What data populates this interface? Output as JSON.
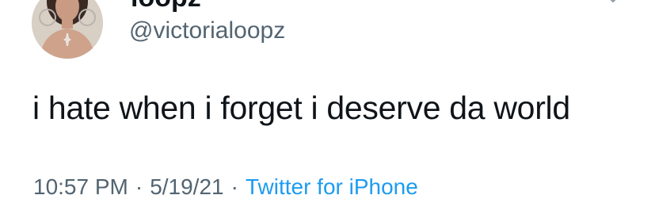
{
  "tweet": {
    "display_name": "loopz",
    "handle": "@victorialoopz",
    "text": "i hate when i forget i deserve da world",
    "time": "10:57 PM",
    "separator": "·",
    "date": "5/19/21",
    "source": "Twitter for iPhone",
    "source_color": "#1d9bf0"
  },
  "icons": {
    "more": "chevron-down-icon",
    "avatar": "profile-photo"
  }
}
